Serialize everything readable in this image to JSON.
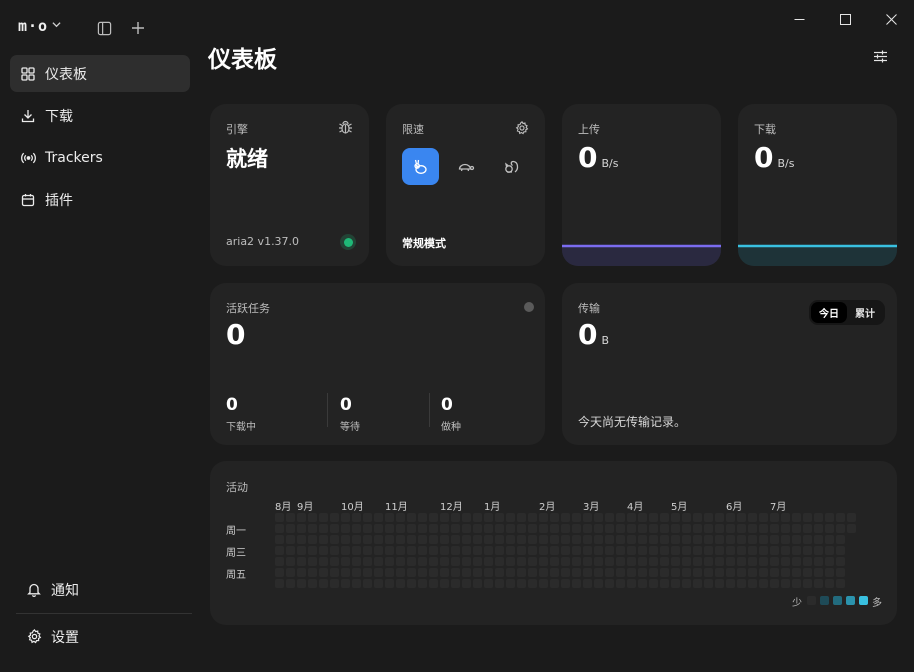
{
  "app": {
    "logo": "m·o"
  },
  "sidebar": {
    "items": [
      {
        "label": "仪表板",
        "icon": "dashboard-grid-icon",
        "active": true
      },
      {
        "label": "下载",
        "icon": "download-icon"
      },
      {
        "label": "Trackers",
        "icon": "tracker-signal-icon"
      },
      {
        "label": "插件",
        "icon": "plugin-calendar-icon"
      }
    ],
    "bottom": [
      {
        "label": "通知",
        "icon": "bell-icon"
      },
      {
        "label": "设置",
        "icon": "gear-icon"
      }
    ]
  },
  "header": {
    "title": "仪表板"
  },
  "engine": {
    "label": "引擎",
    "status": "就绪",
    "version": "aria2 v1.37.0",
    "status_color": "#1fb877"
  },
  "speed_limit": {
    "label": "限速",
    "mode": "常规模式",
    "accent": "#3a86f0",
    "modes": [
      "rabbit-icon",
      "turtle-icon",
      "squirrel-icon"
    ]
  },
  "upload": {
    "label": "上传",
    "value": "0",
    "unit": "B/s",
    "color": "#7b6cf0"
  },
  "download": {
    "label": "下载",
    "value": "0",
    "unit": "B/s",
    "color": "#39c0e0"
  },
  "active_tasks": {
    "label": "活跃任务",
    "value": "0",
    "stats": [
      {
        "value": "0",
        "label": "下载中"
      },
      {
        "value": "0",
        "label": "等待"
      },
      {
        "value": "0",
        "label": "做种"
      }
    ]
  },
  "transfer": {
    "label": "传输",
    "value": "0",
    "unit": "B",
    "tabs": [
      "今日",
      "累计"
    ],
    "active_tab": "今日",
    "empty_text": "今天尚无传输记录。"
  },
  "activity": {
    "label": "活动",
    "months": [
      "8月",
      "9月",
      "10月",
      "11月",
      "12月",
      "1月",
      "2月",
      "3月",
      "4月",
      "5月",
      "6月",
      "7月"
    ],
    "weekdays": [
      "周一",
      "周三",
      "周五"
    ],
    "legend_less": "少",
    "legend_more": "多",
    "legend_colors": [
      "#2b2b2b",
      "#1e4a57",
      "#226b7e",
      "#2b93ad",
      "#39c0e0"
    ]
  }
}
